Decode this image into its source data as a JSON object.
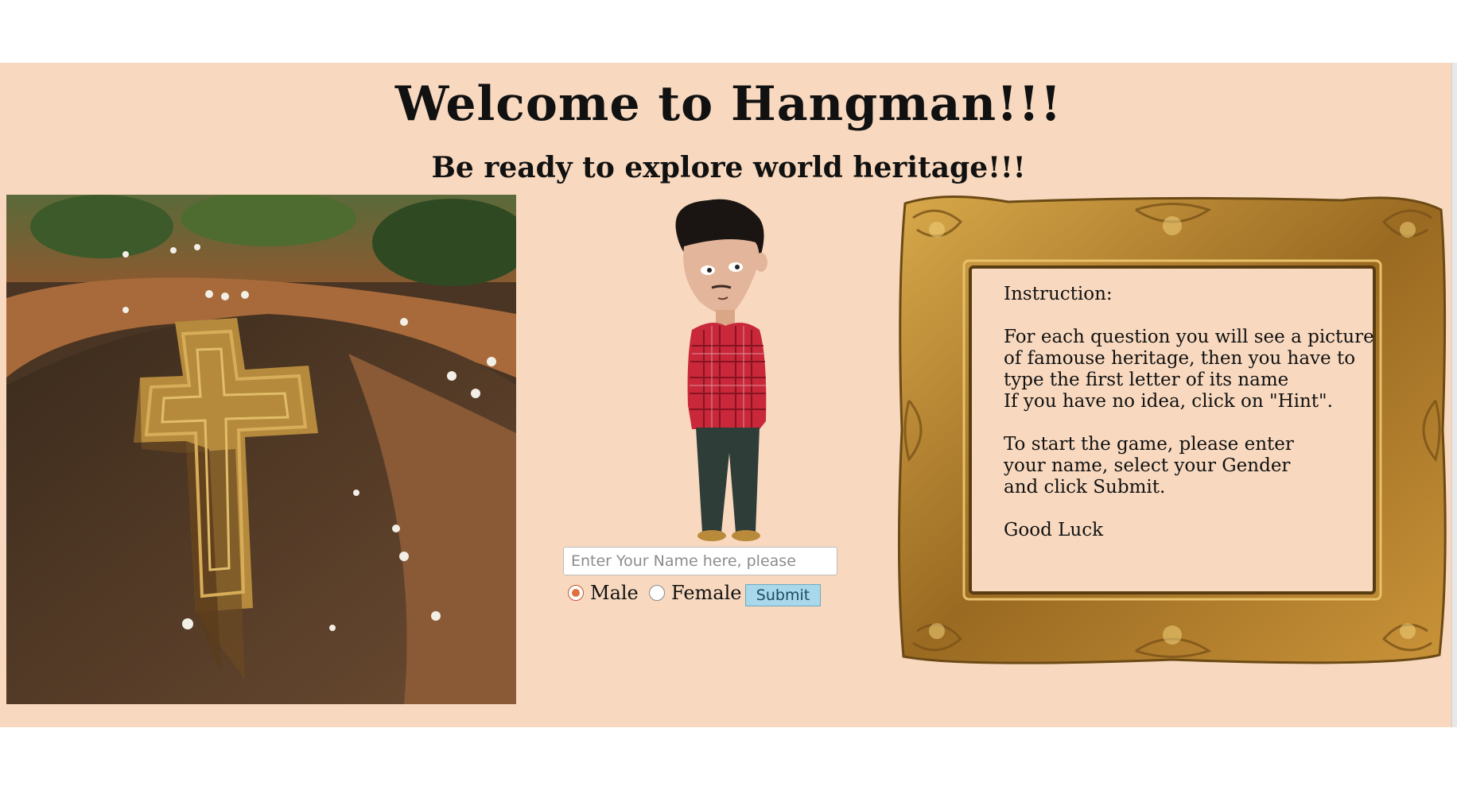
{
  "header": {
    "title": "Welcome to Hangman!!!",
    "subtitle": "Be ready to explore world heritage!!!"
  },
  "form": {
    "name_placeholder": "Enter Your Name here, please",
    "name_value": "",
    "gender_options": [
      {
        "label": "Male",
        "checked": true
      },
      {
        "label": "Female",
        "checked": false
      }
    ],
    "submit_label": "Submit"
  },
  "instructions": {
    "heading": "Instruction:",
    "lines": [
      "For each question you will see a picture",
      "of famouse heritage, then you have to",
      "type the first letter of its name",
      "If you have no idea, click on \"Hint\"."
    ],
    "start_lines": [
      "To start the game, please enter",
      "your name, select your Gender",
      "and click Submit."
    ],
    "closing": "Good Luck"
  },
  "images": {
    "heritage_photo": "rock-hewn-church-photo",
    "character": "cartoon-character-illustration",
    "frame": "ornate-gold-picture-frame"
  },
  "colors": {
    "page_background": "#f8d9bf",
    "outer_background": "#ffffff",
    "frame_gold": "#b8862e",
    "submit_background": "#a9d8ea",
    "radio_checked": "#e0703e"
  }
}
